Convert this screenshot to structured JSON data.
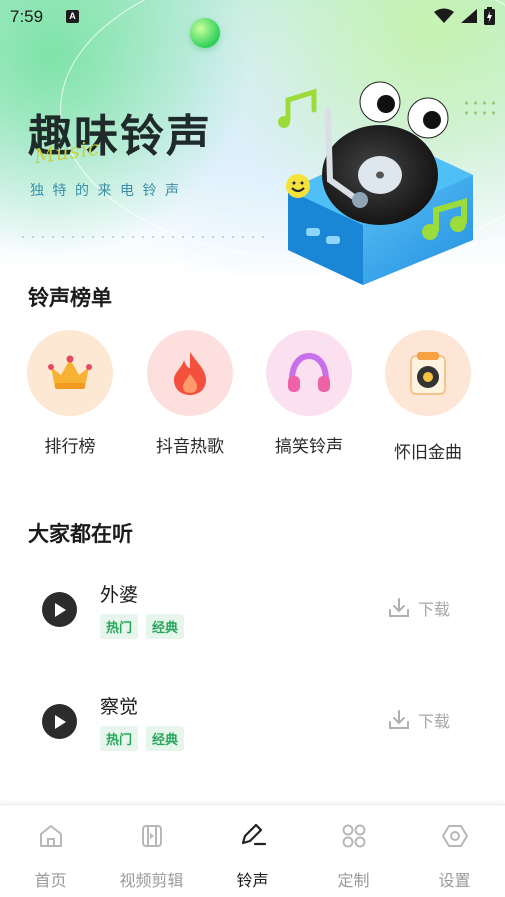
{
  "status_bar": {
    "time": "7:59",
    "notification_badge": "A"
  },
  "hero": {
    "title": "趣味铃声",
    "decoration_text": "Music",
    "subtitle": "独特的来电铃声"
  },
  "ranking": {
    "title": "铃声榜单",
    "items": [
      {
        "label": "排行榜",
        "icon": "crown-icon",
        "bg": "#fde8d3"
      },
      {
        "label": "抖音热歌",
        "icon": "flame-icon",
        "bg": "#fde0dd"
      },
      {
        "label": "搞笑铃声",
        "icon": "headphones-icon",
        "bg": "#fbe1ef"
      },
      {
        "label": "怀旧金曲",
        "icon": "speaker-icon",
        "bg": "#fde6d6"
      }
    ]
  },
  "listening": {
    "title": "大家都在听",
    "songs": [
      {
        "title": "外婆",
        "tags": [
          "热门",
          "经典"
        ],
        "download_label": "下载"
      },
      {
        "title": "察觉",
        "tags": [
          "热门",
          "经典"
        ],
        "download_label": "下载"
      }
    ]
  },
  "bottom_nav": {
    "active_index": 2,
    "items": [
      {
        "label": "首页",
        "icon": "home-icon"
      },
      {
        "label": "视频剪辑",
        "icon": "video-edit-icon"
      },
      {
        "label": "铃声",
        "icon": "pen-icon"
      },
      {
        "label": "定制",
        "icon": "grid-icon"
      },
      {
        "label": "设置",
        "icon": "settings-icon"
      }
    ]
  },
  "colors": {
    "accent_green": "#2aa65c",
    "tag_bg": "#e6f6ec",
    "download_gray": "#a8a8a8"
  }
}
